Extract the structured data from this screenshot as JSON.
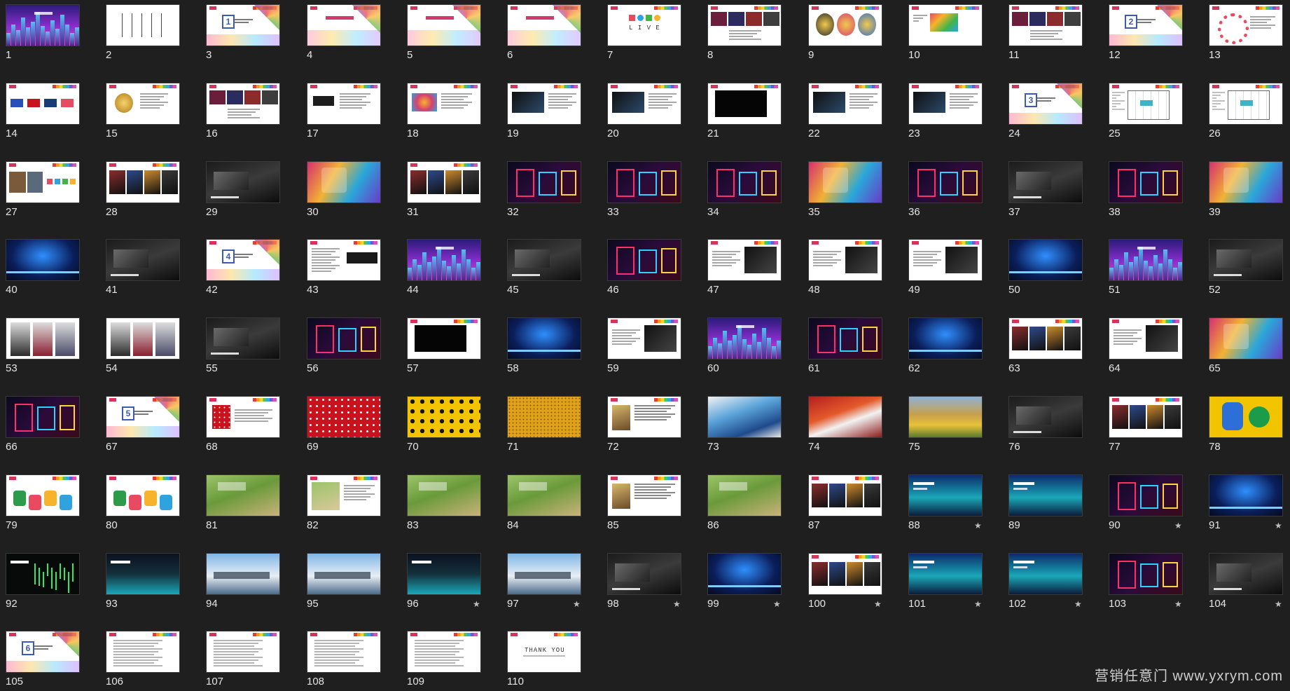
{
  "view": {
    "name": "slide-sorter"
  },
  "palette": {
    "neon_city": "#6a2dd6",
    "dark": "#151515",
    "white": "#ffffff",
    "red": "#c8121d",
    "yellow": "#f2c400",
    "blue": "#2b4fb8",
    "teal": "#1aa7b8"
  },
  "slides": [
    {
      "num": "1",
      "kind": "neon-city"
    },
    {
      "num": "2",
      "kind": "white-lines"
    },
    {
      "num": "3",
      "kind": "section",
      "badge": "1"
    },
    {
      "num": "4",
      "kind": "white-banner"
    },
    {
      "num": "5",
      "kind": "white-banner"
    },
    {
      "num": "6",
      "kind": "white-banner"
    },
    {
      "num": "7",
      "kind": "live",
      "text": "L I V E"
    },
    {
      "num": "8",
      "kind": "photo-strip-dark"
    },
    {
      "num": "9",
      "kind": "three-circles"
    },
    {
      "num": "10",
      "kind": "white-colorbox"
    },
    {
      "num": "11",
      "kind": "photo-strip-dark"
    },
    {
      "num": "12",
      "kind": "section",
      "badge": "2"
    },
    {
      "num": "13",
      "kind": "circle-ring"
    },
    {
      "num": "14",
      "kind": "logos"
    },
    {
      "num": "15",
      "kind": "emblem"
    },
    {
      "num": "16",
      "kind": "photo-strip-dark"
    },
    {
      "num": "17",
      "kind": "logo-text"
    },
    {
      "num": "18",
      "kind": "colorful-logo"
    },
    {
      "num": "19",
      "kind": "dark-image-text"
    },
    {
      "num": "20",
      "kind": "dark-image-text"
    },
    {
      "num": "21",
      "kind": "black-box"
    },
    {
      "num": "22",
      "kind": "dark-image-text"
    },
    {
      "num": "23",
      "kind": "dark-image-text"
    },
    {
      "num": "24",
      "kind": "section",
      "badge": "3"
    },
    {
      "num": "25",
      "kind": "floorplan"
    },
    {
      "num": "26",
      "kind": "floorplan"
    },
    {
      "num": "27",
      "kind": "photos-shapes"
    },
    {
      "num": "28",
      "kind": "photo-mix"
    },
    {
      "num": "29",
      "kind": "dark-photo"
    },
    {
      "num": "30",
      "kind": "colorful-photo"
    },
    {
      "num": "31",
      "kind": "photo-mix"
    },
    {
      "num": "32",
      "kind": "dark-neon"
    },
    {
      "num": "33",
      "kind": "dark-neon"
    },
    {
      "num": "34",
      "kind": "dark-neon"
    },
    {
      "num": "35",
      "kind": "colorful-photo"
    },
    {
      "num": "36",
      "kind": "dark-neon"
    },
    {
      "num": "37",
      "kind": "dark-photo"
    },
    {
      "num": "38",
      "kind": "dark-neon"
    },
    {
      "num": "39",
      "kind": "colorful-photo"
    },
    {
      "num": "40",
      "kind": "stage-blue"
    },
    {
      "num": "41",
      "kind": "dark-photo"
    },
    {
      "num": "42",
      "kind": "section",
      "badge": "4"
    },
    {
      "num": "43",
      "kind": "white-text-dark"
    },
    {
      "num": "44",
      "kind": "neon-city"
    },
    {
      "num": "45",
      "kind": "dark-photo"
    },
    {
      "num": "46",
      "kind": "dark-neon"
    },
    {
      "num": "47",
      "kind": "white-figure"
    },
    {
      "num": "48",
      "kind": "white-figure"
    },
    {
      "num": "49",
      "kind": "white-figure"
    },
    {
      "num": "50",
      "kind": "stage-blue"
    },
    {
      "num": "51",
      "kind": "neon-city"
    },
    {
      "num": "52",
      "kind": "dark-photo"
    },
    {
      "num": "53",
      "kind": "fashion"
    },
    {
      "num": "54",
      "kind": "fashion"
    },
    {
      "num": "55",
      "kind": "dark-photo"
    },
    {
      "num": "56",
      "kind": "dark-neon"
    },
    {
      "num": "57",
      "kind": "black-box"
    },
    {
      "num": "58",
      "kind": "stage-blue"
    },
    {
      "num": "59",
      "kind": "white-figure"
    },
    {
      "num": "60",
      "kind": "neon-city"
    },
    {
      "num": "61",
      "kind": "dark-neon"
    },
    {
      "num": "62",
      "kind": "stage-blue"
    },
    {
      "num": "63",
      "kind": "photo-mix"
    },
    {
      "num": "64",
      "kind": "white-figure"
    },
    {
      "num": "65",
      "kind": "colorful-photo"
    },
    {
      "num": "66",
      "kind": "dark-neon"
    },
    {
      "num": "67",
      "kind": "section",
      "badge": "5"
    },
    {
      "num": "68",
      "kind": "white-red"
    },
    {
      "num": "69",
      "kind": "red-dots"
    },
    {
      "num": "70",
      "kind": "yellow-dots"
    },
    {
      "num": "71",
      "kind": "yellow-field"
    },
    {
      "num": "72",
      "kind": "white-text-photo"
    },
    {
      "num": "73",
      "kind": "blue-painting"
    },
    {
      "num": "74",
      "kind": "red-painting"
    },
    {
      "num": "75",
      "kind": "sunflower"
    },
    {
      "num": "76",
      "kind": "dark-photo"
    },
    {
      "num": "77",
      "kind": "photo-mix"
    },
    {
      "num": "78",
      "kind": "yellow-cartoon"
    },
    {
      "num": "79",
      "kind": "white-cartoon"
    },
    {
      "num": "80",
      "kind": "white-cartoon"
    },
    {
      "num": "81",
      "kind": "green-map"
    },
    {
      "num": "82",
      "kind": "white-map"
    },
    {
      "num": "83",
      "kind": "green-map"
    },
    {
      "num": "84",
      "kind": "green-map"
    },
    {
      "num": "85",
      "kind": "white-text-photo"
    },
    {
      "num": "86",
      "kind": "green-map"
    },
    {
      "num": "87",
      "kind": "photo-mix"
    },
    {
      "num": "88",
      "kind": "teal-blue",
      "star": "★"
    },
    {
      "num": "89",
      "kind": "teal-blue"
    },
    {
      "num": "90",
      "kind": "dark-neon",
      "star": "★"
    },
    {
      "num": "91",
      "kind": "stage-blue",
      "star": "★"
    },
    {
      "num": "92",
      "kind": "green-lines"
    },
    {
      "num": "93",
      "kind": "teal-dark"
    },
    {
      "num": "94",
      "kind": "sky-photo"
    },
    {
      "num": "95",
      "kind": "sky-photo"
    },
    {
      "num": "96",
      "kind": "teal-dark",
      "star": "★"
    },
    {
      "num": "97",
      "kind": "sky-photo",
      "star": "★"
    },
    {
      "num": "98",
      "kind": "dark-photo",
      "star": "★"
    },
    {
      "num": "99",
      "kind": "stage-blue",
      "star": "★"
    },
    {
      "num": "100",
      "kind": "photo-mix",
      "star": "★"
    },
    {
      "num": "101",
      "kind": "teal-blue",
      "star": "★"
    },
    {
      "num": "102",
      "kind": "teal-blue",
      "star": "★"
    },
    {
      "num": "103",
      "kind": "dark-neon",
      "star": "★"
    },
    {
      "num": "104",
      "kind": "dark-photo",
      "star": "★"
    },
    {
      "num": "105",
      "kind": "section",
      "badge": "6"
    },
    {
      "num": "106",
      "kind": "white-doc"
    },
    {
      "num": "107",
      "kind": "white-doc"
    },
    {
      "num": "108",
      "kind": "white-doc"
    },
    {
      "num": "109",
      "kind": "white-doc"
    },
    {
      "num": "110",
      "kind": "thankyou",
      "text": "THANK YOU"
    }
  ],
  "watermark": "营销任意门 www.yxrym.com"
}
